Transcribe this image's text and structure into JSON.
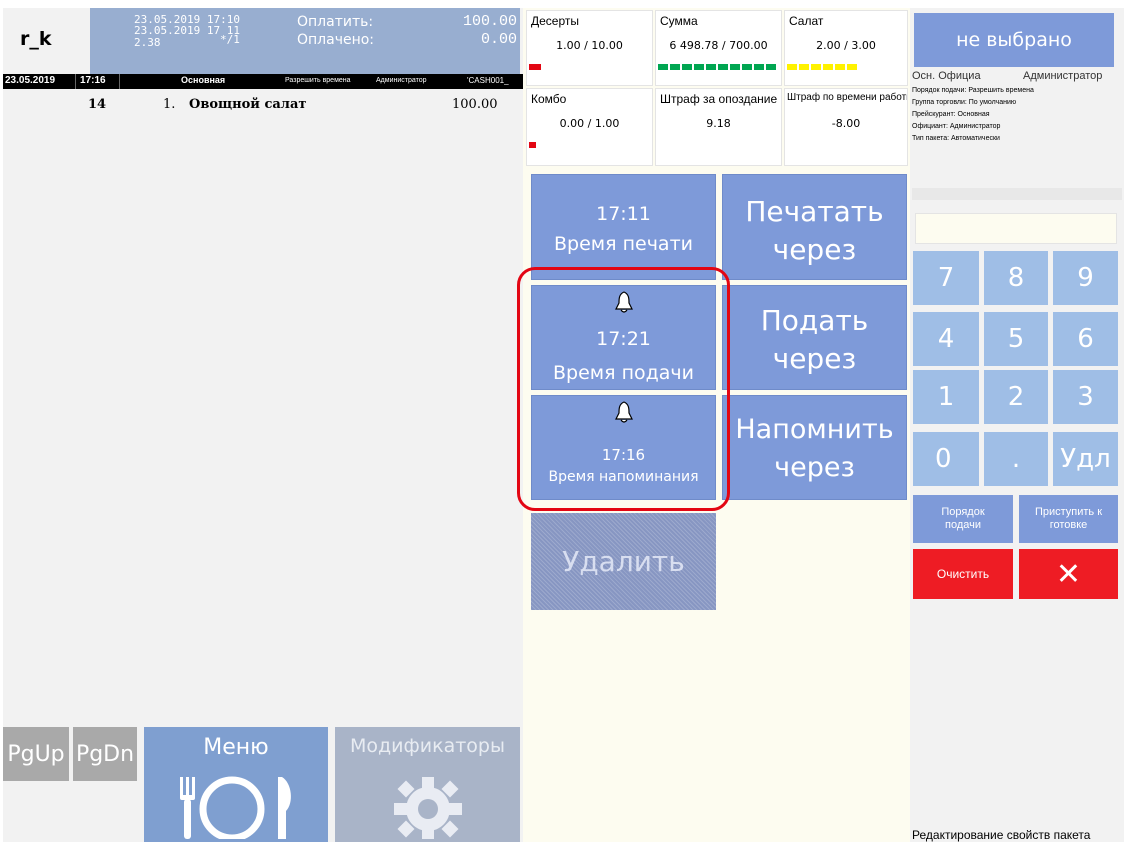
{
  "header": {
    "user": "r_k",
    "check_date1": "23.05.2019 17:10",
    "check_date2": "23.05.2019 17 11",
    "check_num": "2.38",
    "check_guests": "*/1",
    "pay_label": "Оплатить:",
    "pay_value": "100.00",
    "paid_label": "Оплачено:",
    "paid_value": "0.00"
  },
  "status_bar": {
    "date": "23.05.2019",
    "time": "17:16",
    "course": "Основная",
    "serve_mode": "Разрешить времена",
    "role": "Администратор",
    "station": "'CASH001_"
  },
  "order_line": {
    "qty": "14",
    "index": "1.",
    "name": "Овощной салат",
    "price": "100.00"
  },
  "left_buttons": {
    "pgup": "PgUp",
    "pgdn": "PgDn",
    "menu": "Меню",
    "modifiers": "Модификаторы"
  },
  "stats": [
    {
      "title": "Десерты",
      "value": "1.00 / 10.00"
    },
    {
      "title": "Сумма",
      "value": "6 498.78 / 700.00"
    },
    {
      "title": "Салат",
      "value": "2.00 / 3.00"
    },
    {
      "title": "Комбо",
      "value": "0.00 / 1.00"
    },
    {
      "title": "Штраф за опоздание",
      "value": "9.18"
    },
    {
      "title": "Штраф по времени работы",
      "value": "-8.00"
    }
  ],
  "progress": {
    "desserts": 0.1,
    "sum": 1.0,
    "salad": 0.67,
    "combo": 0.0
  },
  "times": {
    "print_time": "17:11",
    "print_caption": "Время печати",
    "serve_time": "17:21",
    "serve_caption": "Время подачи",
    "remind_time": "17:16",
    "remind_caption": "Время напоминания"
  },
  "actions": {
    "print_line1": "Печатать",
    "print_line2": "через",
    "serve_line1": "Подать",
    "serve_line2": "через",
    "remind_line1": "Напомнить",
    "remind_line2": "через",
    "delete": "Удалить"
  },
  "right": {
    "not_selected": "не выбрано",
    "info_main_left": "Осн. Официа",
    "info_main_right": "Администратор",
    "info_lines": [
      "Порядок подачи: Разрешить времена",
      "Группа торговли: По умолчанию",
      "Прейскурант: Основная",
      "Официант: Администратор",
      "Тип пакета: Автоматически"
    ],
    "keys": [
      "7",
      "8",
      "9",
      "4",
      "5",
      "6",
      "1",
      "2",
      "3",
      "0",
      ".",
      "Удл"
    ],
    "order_btn": "Порядок подачи",
    "start_btn": "Приступить к готовке",
    "clear_btn": "Очистить",
    "close_btn": "✕",
    "footer": "Редактирование свойств пакета"
  },
  "colors": {
    "accent_blue": "#7e9ad9",
    "key_blue": "#9fbee6",
    "danger": "#ee1c24",
    "highlight": "#e30613",
    "bar_red": "#e30613",
    "bar_green": "#00a651",
    "bar_yellow": "#fff200"
  },
  "icons": [
    "bell-icon",
    "plate-cutlery-icon",
    "gear-icon",
    "close-icon"
  ]
}
